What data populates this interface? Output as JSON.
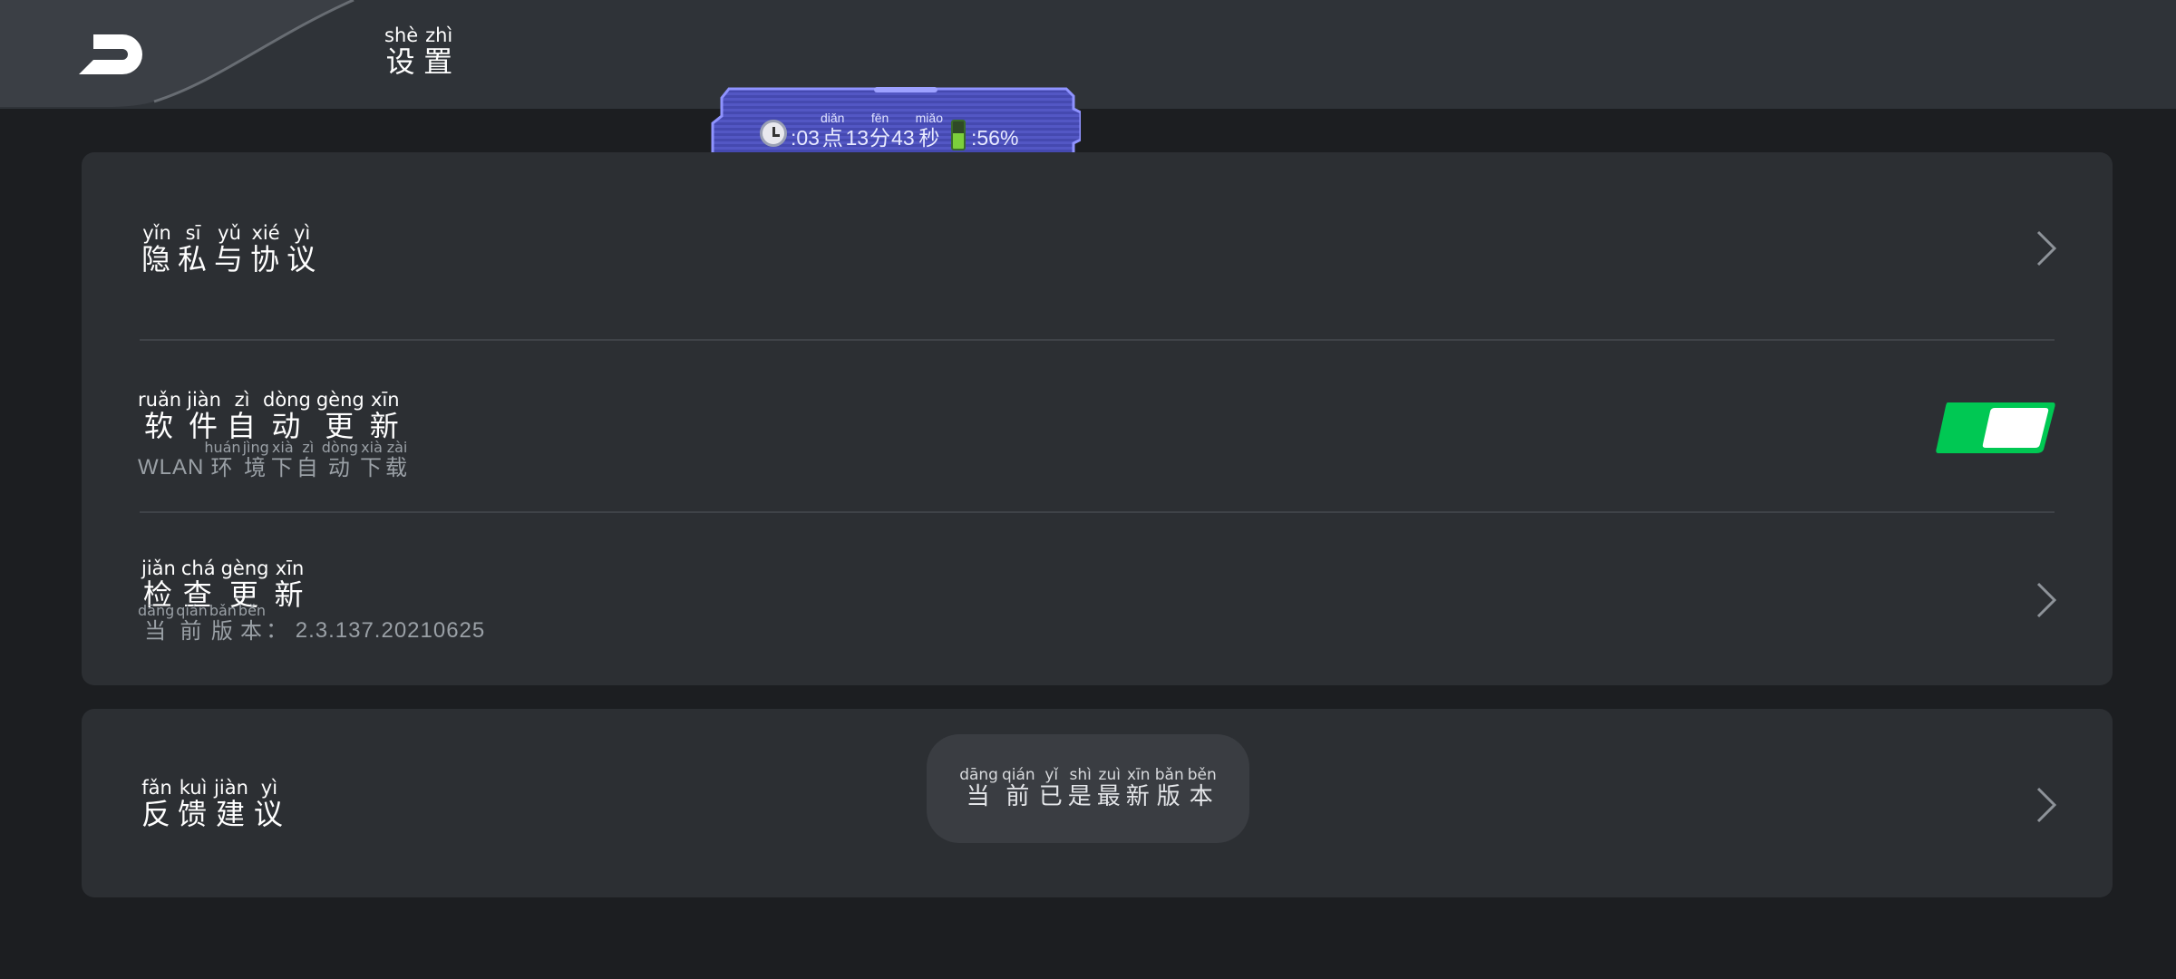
{
  "header": {
    "title": [
      {
        "py": "shè",
        "hz": "设"
      },
      {
        "py": "zhì",
        "hz": "置"
      }
    ]
  },
  "status_chip": {
    "hour_prefix": ":03",
    "hour_unit": {
      "py": "diǎn",
      "hz": "点"
    },
    "minute_value": "13",
    "minute_unit": {
      "py": "fēn",
      "hz": "分"
    },
    "second_value": "43",
    "second_unit": {
      "py": "miǎo",
      "hz": "秒"
    },
    "battery_text": ":56%",
    "battery_level": 0.56
  },
  "settings": {
    "privacy": {
      "title": [
        {
          "py": "yǐn",
          "hz": "隐"
        },
        {
          "py": "sī",
          "hz": "私"
        },
        {
          "py": "yǔ",
          "hz": "与"
        },
        {
          "py": "xié",
          "hz": "协"
        },
        {
          "py": "yì",
          "hz": "议"
        }
      ]
    },
    "auto_update": {
      "title": [
        {
          "py": "ruǎn",
          "hz": "软"
        },
        {
          "py": "jiàn",
          "hz": "件"
        },
        {
          "py": "zì",
          "hz": "自"
        },
        {
          "py": "dòng",
          "hz": "动"
        },
        {
          "py": "gèng",
          "hz": "更"
        },
        {
          "py": "xīn",
          "hz": "新"
        }
      ],
      "subtitle_prefix": "WLAN",
      "subtitle": [
        {
          "py": "huán",
          "hz": "环"
        },
        {
          "py": "jìng",
          "hz": "境"
        },
        {
          "py": "xià",
          "hz": "下"
        },
        {
          "py": "zì",
          "hz": "自"
        },
        {
          "py": "dòng",
          "hz": "动"
        },
        {
          "py": "xià",
          "hz": "下"
        },
        {
          "py": "zài",
          "hz": "载"
        }
      ],
      "enabled": true
    },
    "check_update": {
      "title": [
        {
          "py": "jiǎn",
          "hz": "检"
        },
        {
          "py": "chá",
          "hz": "查"
        },
        {
          "py": "gèng",
          "hz": "更"
        },
        {
          "py": "xīn",
          "hz": "新"
        }
      ],
      "subtitle": [
        {
          "py": "dāng",
          "hz": "当"
        },
        {
          "py": "qián",
          "hz": "前"
        },
        {
          "py": "bǎn",
          "hz": "版"
        },
        {
          "py": "běn",
          "hz": "本"
        }
      ],
      "subtitle_suffix": "： 2.3.137.20210625"
    },
    "feedback": {
      "title": [
        {
          "py": "fǎn",
          "hz": "反"
        },
        {
          "py": "kuì",
          "hz": "馈"
        },
        {
          "py": "jiàn",
          "hz": "建"
        },
        {
          "py": "yì",
          "hz": "议"
        }
      ]
    }
  },
  "toast": {
    "text": [
      {
        "py": "dāng",
        "hz": "当"
      },
      {
        "py": "qián",
        "hz": "前"
      },
      {
        "py": "yǐ",
        "hz": "已"
      },
      {
        "py": "shì",
        "hz": "是"
      },
      {
        "py": "zuì",
        "hz": "最"
      },
      {
        "py": "xīn",
        "hz": "新"
      },
      {
        "py": "bǎn",
        "hz": "版"
      },
      {
        "py": "běn",
        "hz": "本"
      }
    ]
  },
  "colors": {
    "toggle_on": "#00c853",
    "status_chip": "#4b4fb8"
  }
}
